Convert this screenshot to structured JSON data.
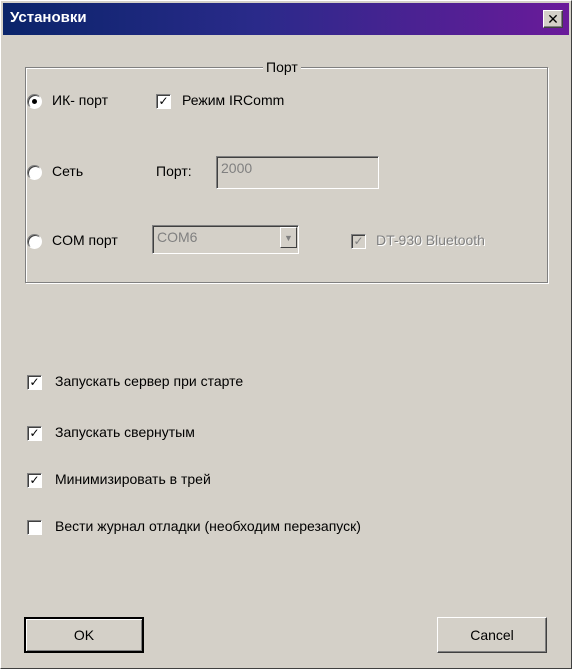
{
  "window": {
    "title": "Установки",
    "close_glyph": "✕"
  },
  "port_group": {
    "legend": "Порт",
    "ir": {
      "label": "ИК- порт",
      "selected": true
    },
    "irda_mode": {
      "label": "Режим IRComm",
      "checked": true
    },
    "network": {
      "label": "Сеть",
      "selected": false
    },
    "network_port": {
      "label": "Порт:",
      "value": "2000"
    },
    "com": {
      "label": "COM порт",
      "selected": false
    },
    "com_select": {
      "value": "COM6",
      "arrow": "▼"
    },
    "bluetooth": {
      "label": "DT-930 Bluetooth",
      "checked": true,
      "disabled": true
    }
  },
  "options": [
    {
      "label": "Запускать сервер при старте",
      "checked": true
    },
    {
      "label": "Запускать свернутым",
      "checked": true
    },
    {
      "label": "Минимизировать в трей",
      "checked": true
    },
    {
      "label": "Вести журнал отладки (необходим перезапуск)",
      "checked": false
    }
  ],
  "check_glyph": "✓",
  "buttons": {
    "ok": "OK",
    "cancel": "Cancel"
  },
  "colors": {
    "titlebar_start": "#0a246a",
    "titlebar_end": "#6a1a9a",
    "face": "#d4d0c8"
  }
}
